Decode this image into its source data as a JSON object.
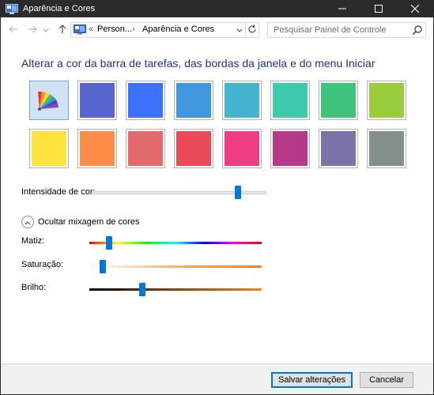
{
  "window": {
    "title": "Aparência e Cores",
    "controls": {
      "minimize": "minimize-icon",
      "maximize": "maximize-icon",
      "close": "close-icon"
    }
  },
  "nav": {
    "breadcrumb_prefix": "«",
    "breadcrumb": [
      "Person...",
      "Aparência e Cores"
    ],
    "breadcrumb_separator": "›",
    "search_placeholder": "Pesquisar Painel de Controle"
  },
  "content": {
    "heading": "Alterar a cor da barra de tarefas, das bordas da janela e do menu Iniciar",
    "swatches": [
      {
        "id": "automatic",
        "color": "#cfe3f5",
        "icon": "color-fan-icon",
        "selected": true
      },
      {
        "id": "blue-violet",
        "color": "#5766cf",
        "selected": false
      },
      {
        "id": "blue",
        "color": "#3f71ff",
        "selected": false
      },
      {
        "id": "sky",
        "color": "#4099e0",
        "selected": false
      },
      {
        "id": "teal",
        "color": "#43b4cb",
        "selected": false
      },
      {
        "id": "mint",
        "color": "#3ecbad",
        "selected": false
      },
      {
        "id": "green",
        "color": "#3fc37a",
        "selected": false
      },
      {
        "id": "lime",
        "color": "#9bcc3d",
        "selected": false
      },
      {
        "id": "yellow",
        "color": "#ffe440",
        "selected": false
      },
      {
        "id": "orange",
        "color": "#ff8c48",
        "selected": false
      },
      {
        "id": "salmon",
        "color": "#e46b6d",
        "selected": false
      },
      {
        "id": "red",
        "color": "#ea4a5a",
        "selected": false
      },
      {
        "id": "pink",
        "color": "#ef3d84",
        "selected": false
      },
      {
        "id": "magenta",
        "color": "#b7398a",
        "selected": false
      },
      {
        "id": "lavender",
        "color": "#7c72a8",
        "selected": false
      },
      {
        "id": "gray-green",
        "color": "#839089",
        "selected": false
      }
    ],
    "intensity_label": "Intensidade de cor:",
    "intensity_value": 0.85,
    "mixer_toggle_label": "Ocultar mixagem de cores",
    "hue_label": "Matiz:",
    "hue_value": 0.1,
    "saturation_label": "Saturação:",
    "saturation_value": 0.06,
    "brightness_label": "Brilho:",
    "brightness_value": 0.3
  },
  "buttons": {
    "save": "Salvar alterações",
    "cancel": "Cancelar"
  },
  "colors": {
    "accent": "#0078d7",
    "heading": "#1e3287",
    "titlebar": "#2b2b2b"
  }
}
